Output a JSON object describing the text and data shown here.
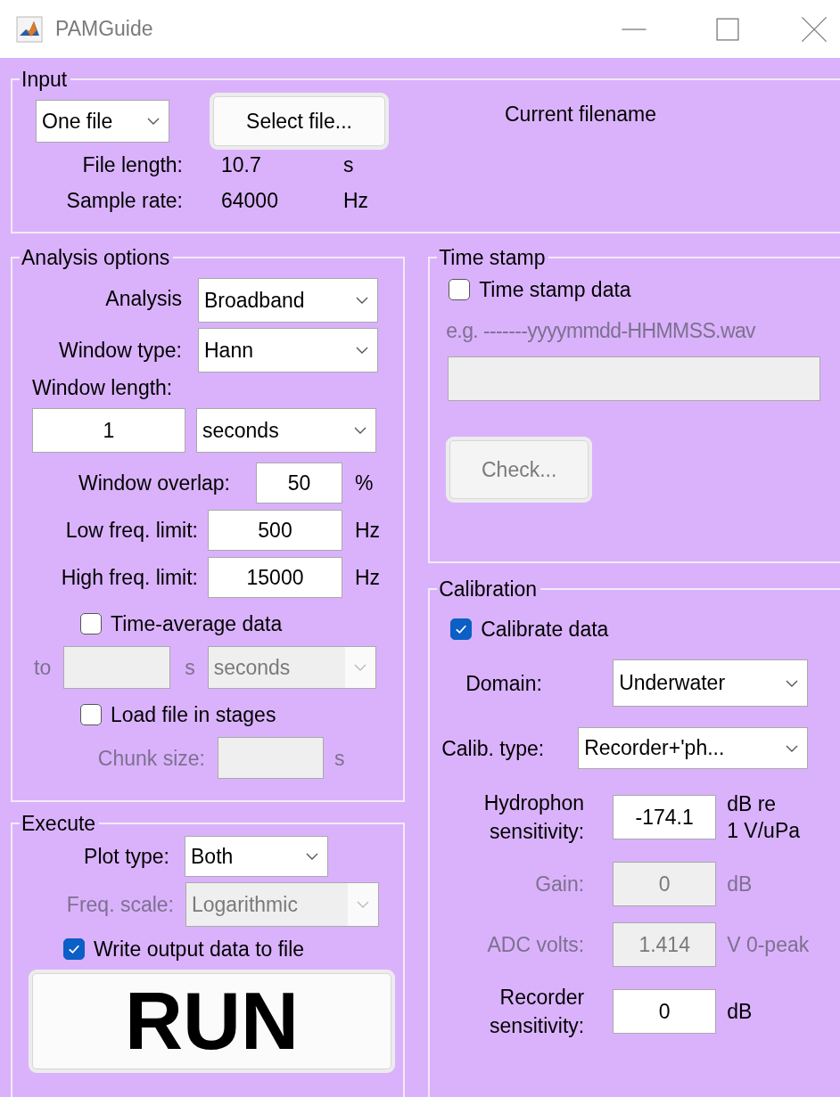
{
  "window": {
    "title": "PAMGuide"
  },
  "input": {
    "title": "Input",
    "file_mode": {
      "value": "One file",
      "disabled": false
    },
    "select_button": {
      "label": "Select file...",
      "disabled": false
    },
    "current_filename": "Current filename",
    "info": [
      {
        "label": "File length:",
        "value": "10.7",
        "unit": "s"
      },
      {
        "label": "Sample rate:",
        "value": "64000",
        "unit": "Hz"
      }
    ]
  },
  "analysis_options": {
    "title": "Analysis options",
    "analysis_type": {
      "label": "Analysis",
      "value": "Broadband",
      "disabled": false
    },
    "window_type": {
      "label": "Window type:",
      "value": "Hann",
      "disabled": false
    },
    "window_length": {
      "label": "Window length:",
      "value": "1",
      "disabled": false,
      "unit": {
        "value": "seconds",
        "disabled": false
      }
    },
    "limits": [
      {
        "label": "Window overlap:",
        "value": "50",
        "unit": "%",
        "disabled": false
      },
      {
        "label": "Low freq. limit:",
        "value": "500",
        "unit": "Hz",
        "disabled": false
      },
      {
        "label": "High freq. limit:",
        "value": "15000",
        "unit": "Hz",
        "disabled": false
      }
    ],
    "time_average": {
      "label": "Time-average data",
      "checked": false
    },
    "average_to": {
      "label": "to",
      "unit": "s",
      "disabled": true,
      "period": {
        "value": "seconds",
        "disabled": true
      }
    },
    "load_in_stages": {
      "label": "Load file in stages",
      "checked": false
    },
    "chunk_size": {
      "label": "Chunk size:",
      "unit": "s",
      "disabled": true
    }
  },
  "execute": {
    "title": "Execute",
    "plot_type": {
      "label": "Plot type:",
      "value": "Both",
      "disabled": false
    },
    "freq_scale": {
      "label": "Freq. scale:",
      "value": "Logarithmic",
      "disabled": true
    },
    "write_output": {
      "label": "Write output data to file",
      "checked": true
    },
    "run_button": {
      "label": "RUN"
    }
  },
  "time_stamp": {
    "title": "Time stamp",
    "time_stamp_data": {
      "label": "Time stamp data",
      "checked": false
    },
    "format_hint": {
      "text": "e.g. -------yyyymmdd-HHMMSS.wav",
      "disabled": true
    },
    "format_field": {
      "disabled": true
    },
    "check_button": {
      "label": "Check...",
      "disabled": true
    }
  },
  "calibration": {
    "title": "Calibration",
    "calibrate_data": {
      "label": "Calibrate data",
      "checked": true
    },
    "domain": {
      "label": "Domain:",
      "value": "Underwater",
      "disabled": false
    },
    "calib_type": {
      "label": "Calib. type:",
      "value": "Recorder+'ph...",
      "disabled": false
    },
    "fields": [
      {
        "label": "Hydrophon sensitivity:",
        "value": "-174.1",
        "unit": "dB re\n1 V/uPa",
        "disabled": false
      },
      {
        "label": "Gain:",
        "value": "0",
        "unit": "dB",
        "disabled": true
      },
      {
        "label": "ADC volts:",
        "value": "1.414",
        "unit": "V 0-peak",
        "disabled": true
      },
      {
        "label": "Recorder sensitivity:",
        "value": "0",
        "unit": "dB",
        "disabled": false
      }
    ]
  }
}
